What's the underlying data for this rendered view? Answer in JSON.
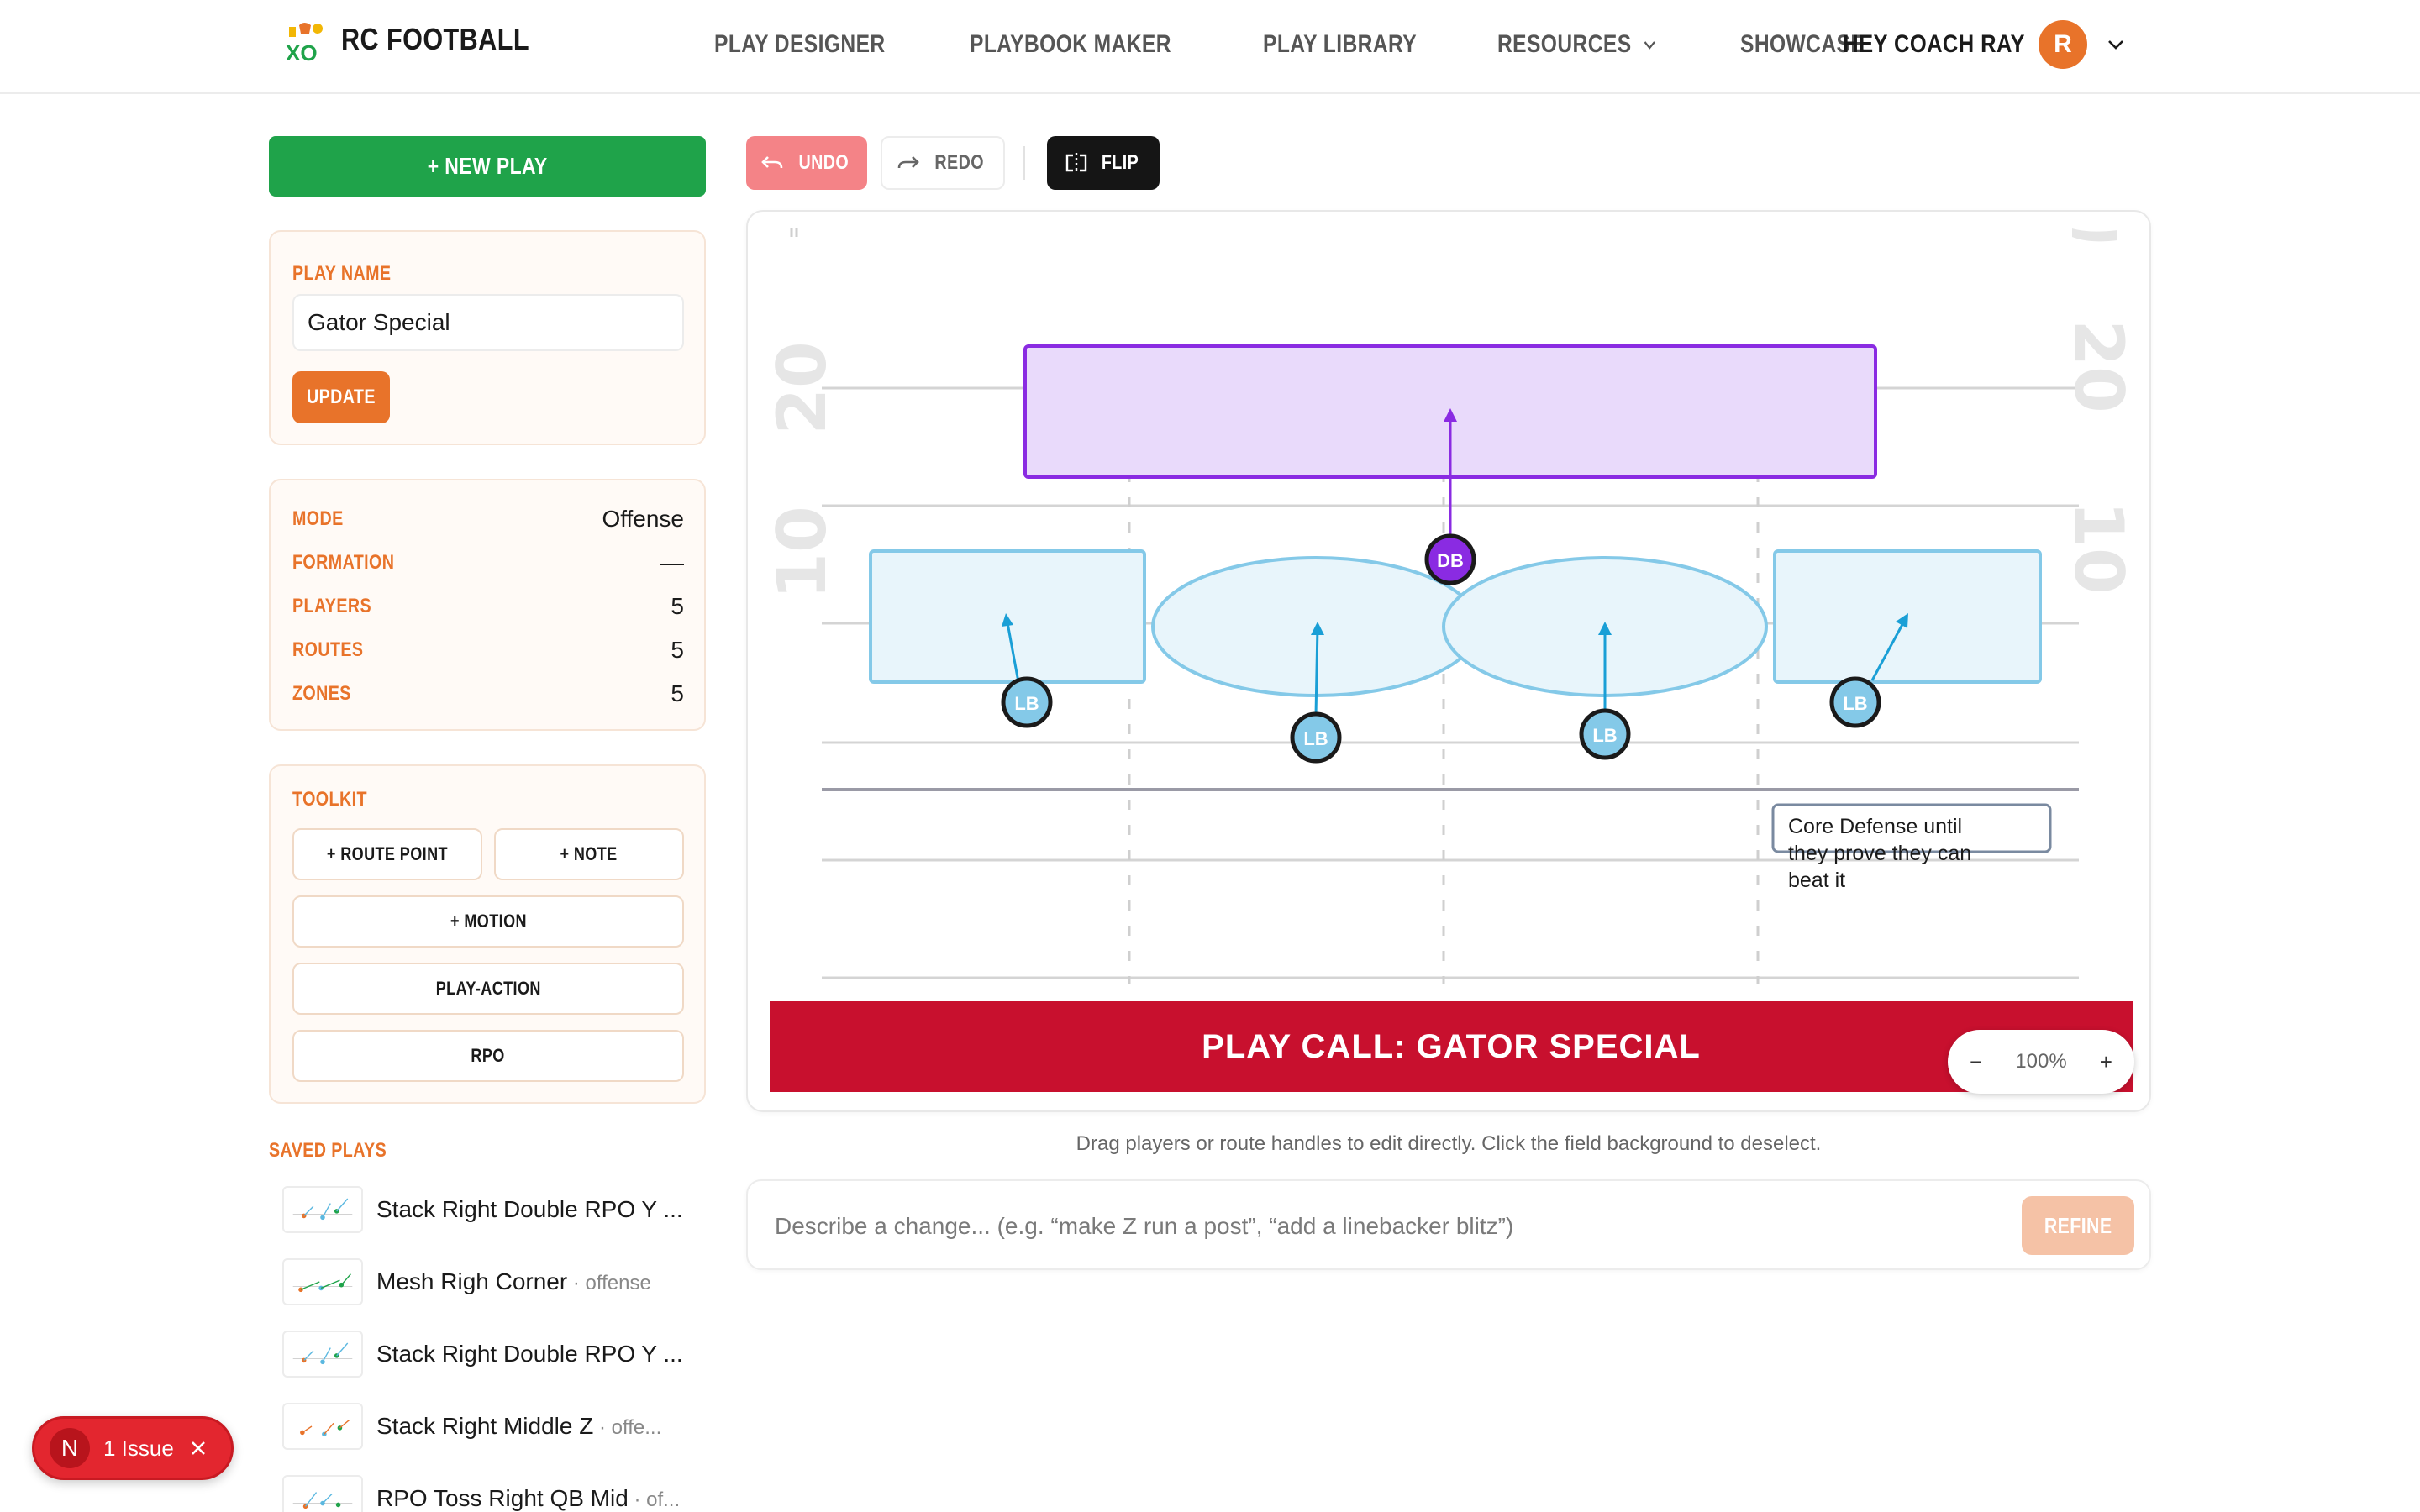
{
  "header": {
    "brand": "RC FOOTBALL",
    "nav": [
      {
        "label": "PLAY DESIGNER"
      },
      {
        "label": "PLAYBOOK MAKER"
      },
      {
        "label": "PLAY LIBRARY"
      },
      {
        "label": "RESOURCES"
      },
      {
        "label": "SHOWCASE"
      }
    ],
    "greeting": "HEY COACH RAY",
    "avatar_initial": "R"
  },
  "sidebar": {
    "new_play_label": "+ NEW PLAY",
    "play_name_label": "PLAY NAME",
    "play_name_value": "Gator Special",
    "update_label": "UPDATE",
    "info": [
      {
        "label": "MODE",
        "value": "Offense"
      },
      {
        "label": "FORMATION",
        "value": "—"
      },
      {
        "label": "PLAYERS",
        "value": "5"
      },
      {
        "label": "ROUTES",
        "value": "5"
      },
      {
        "label": "ZONES",
        "value": "5"
      }
    ],
    "toolkit_label": "TOOLKIT",
    "toolkit": {
      "route_point": "+ ROUTE POINT",
      "note": "+ NOTE",
      "motion": "+ MOTION",
      "play_action": "PLAY-ACTION",
      "rpo": "RPO"
    },
    "saved_label": "SAVED PLAYS",
    "saved_plays": [
      {
        "title": "Stack Right Double RPO Y ...",
        "meta": ""
      },
      {
        "title": "Mesh Righ Corner",
        "meta": " · offense"
      },
      {
        "title": "Stack Right Double RPO Y ...",
        "meta": ""
      },
      {
        "title": "Stack Right Middle Z",
        "meta": " · offe..."
      },
      {
        "title": "RPO Toss Right QB Mid",
        "meta": " · of..."
      }
    ]
  },
  "issue": {
    "badge": "N",
    "label": "1 Issue"
  },
  "toolbar": {
    "undo": "UNDO",
    "redo": "REDO",
    "flip": "FLIP"
  },
  "field": {
    "yard_numbers": {
      "twenty": "20",
      "ten": "10"
    },
    "players": [
      {
        "label": "DB",
        "role": "defensive-back"
      },
      {
        "label": "LB",
        "role": "linebacker"
      },
      {
        "label": "LB",
        "role": "linebacker"
      },
      {
        "label": "LB",
        "role": "linebacker"
      },
      {
        "label": "LB",
        "role": "linebacker"
      }
    ],
    "note_lines": [
      "Core Defense until",
      "they prove they can",
      "beat it"
    ],
    "play_call": "PLAY CALL: GATOR SPECIAL",
    "zoom": {
      "minus": "−",
      "level": "100%",
      "plus": "+"
    },
    "colors": {
      "deep_zone": "#8a2be2",
      "underneath_zone": "#5bb8e0",
      "banner": "#c8102e"
    }
  },
  "helper_text": "Drag players or route handles to edit directly. Click the field background to deselect.",
  "refine": {
    "placeholder": "Describe a change... (e.g. “make Z run a post”, “add a linebacker blitz”)",
    "button": "REFINE"
  }
}
